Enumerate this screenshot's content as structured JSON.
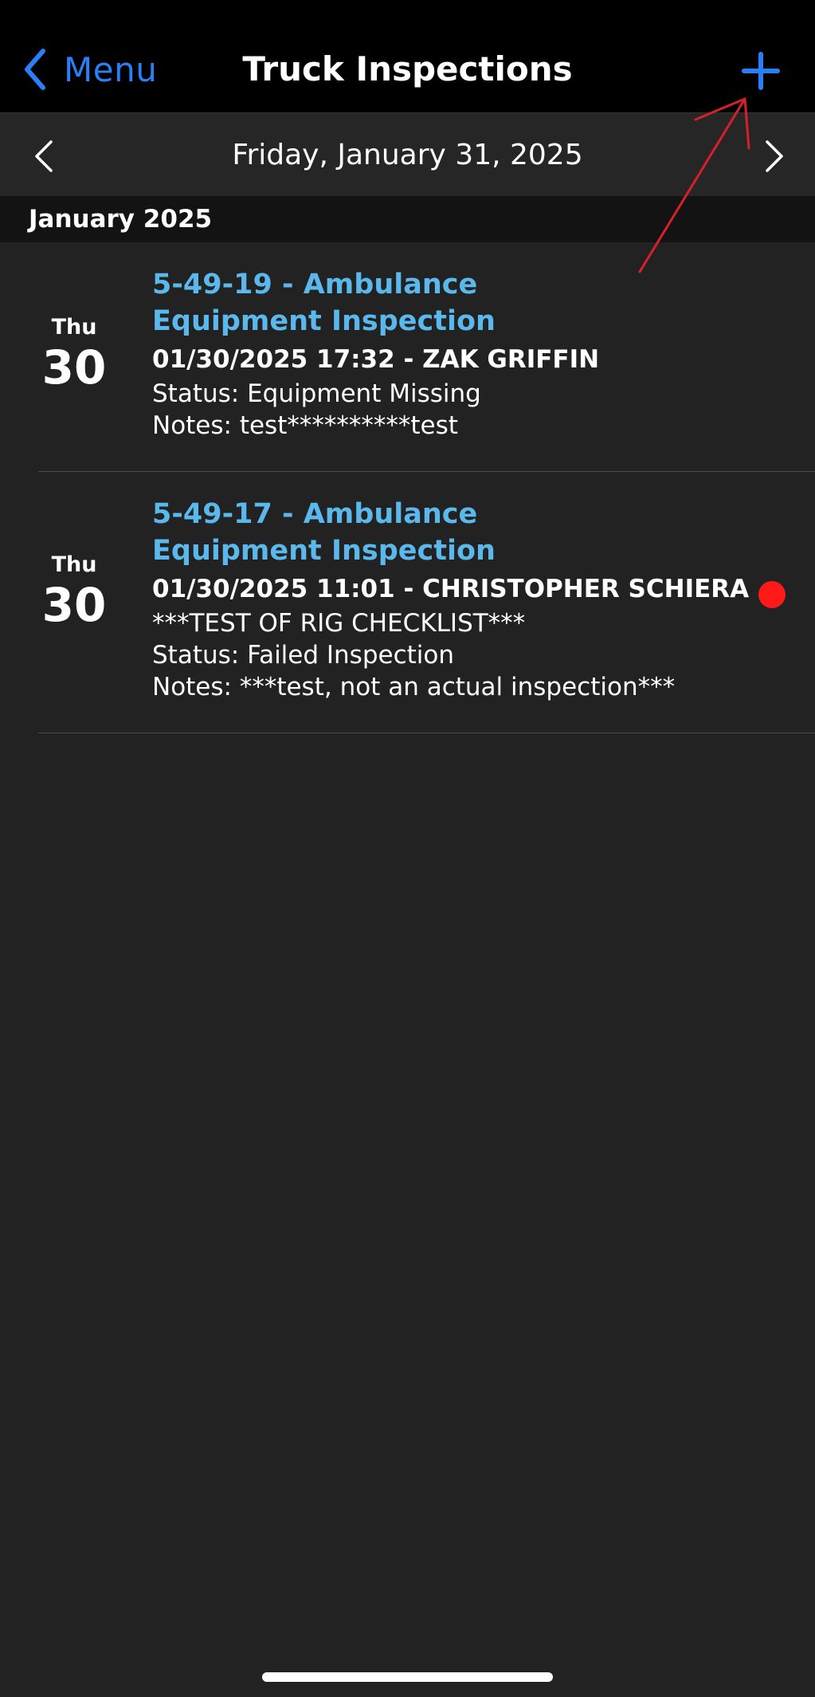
{
  "nav": {
    "back_label": "Menu",
    "title": "Truck Inspections",
    "back_icon": "chevron-left-icon",
    "add_icon": "plus-icon"
  },
  "date_bar": {
    "label": "Friday, January 31, 2025",
    "prev_icon": "chevron-left-icon",
    "next_icon": "chevron-right-icon"
  },
  "section": {
    "label": "January 2025"
  },
  "inspections": [
    {
      "day_of_week": "Thu",
      "day_of_month": "30",
      "title_line1": "5-49-19 - Ambulance",
      "title_line2": "Equipment Inspection",
      "subtitle": "01/30/2025 17:32 - ZAK GRIFFIN",
      "lines": [
        "Status: Equipment Missing",
        "Notes: test**********test"
      ],
      "flagged": false
    },
    {
      "day_of_week": "Thu",
      "day_of_month": "30",
      "title_line1": "5-49-17 - Ambulance",
      "title_line2": "Equipment Inspection",
      "subtitle": "01/30/2025 11:01 - CHRISTOPHER SCHIERA",
      "lines": [
        "***TEST OF RIG CHECKLIST***",
        "Status: Failed Inspection",
        "Notes: ***test, not an actual inspection***"
      ],
      "flagged": true
    }
  ],
  "colors": {
    "accent": "#2a7ff6",
    "title_blue": "#5ab8ec",
    "background": "#222222",
    "nav_background": "#000000",
    "flag_red": "#ff1a1a",
    "annotation_red": "#d6202b"
  }
}
